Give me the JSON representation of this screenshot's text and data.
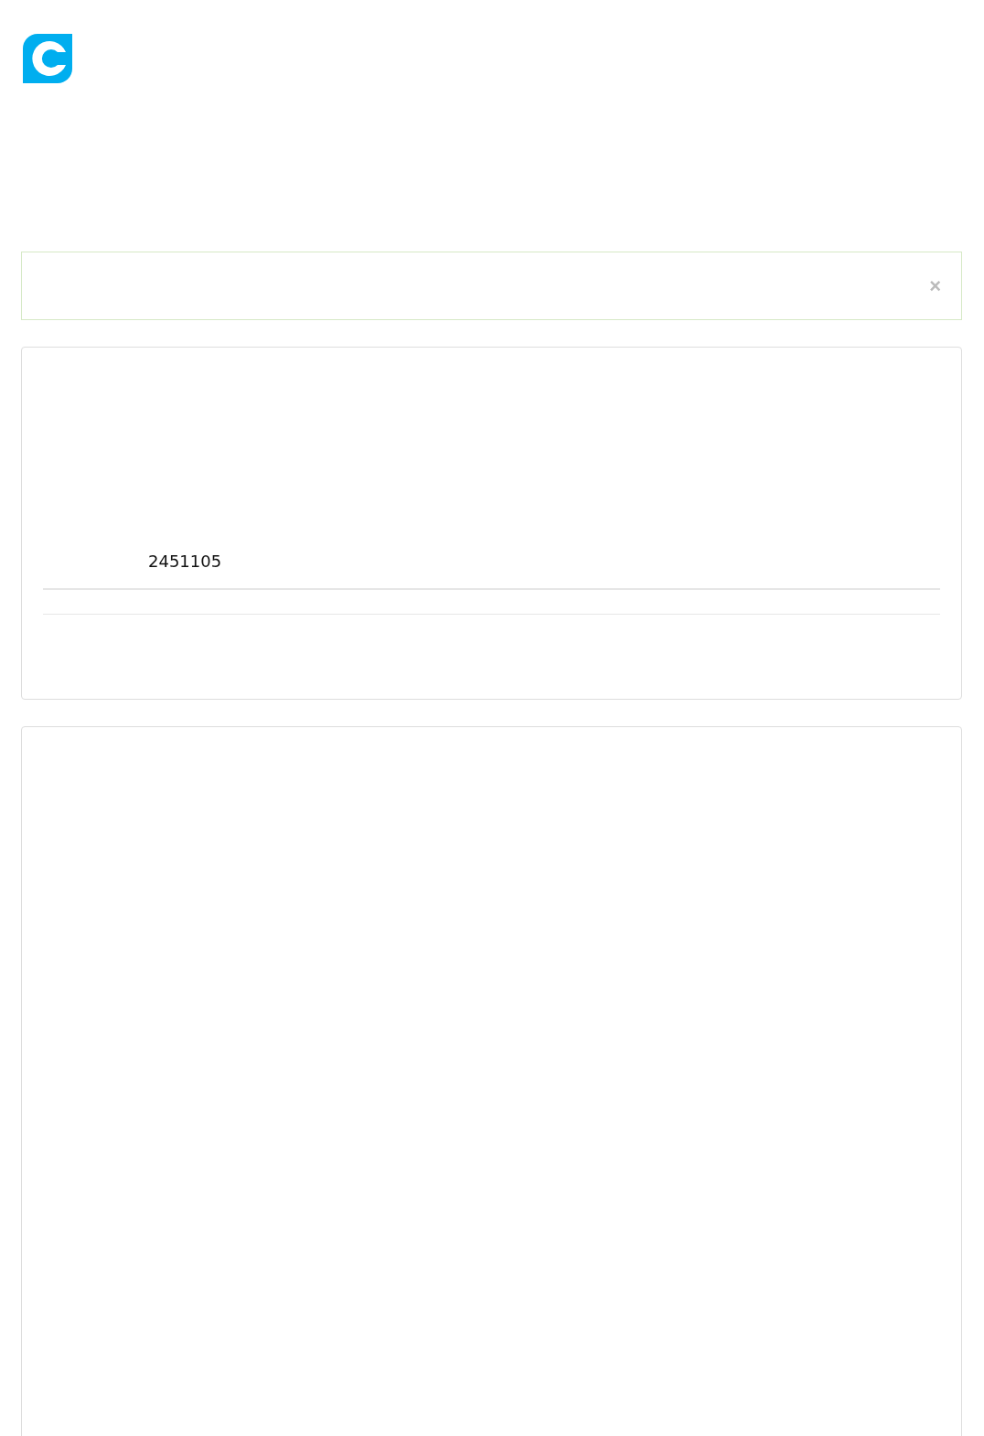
{
  "alert": {
    "close": "×"
  },
  "order_panel": {
    "number": "2451105"
  }
}
